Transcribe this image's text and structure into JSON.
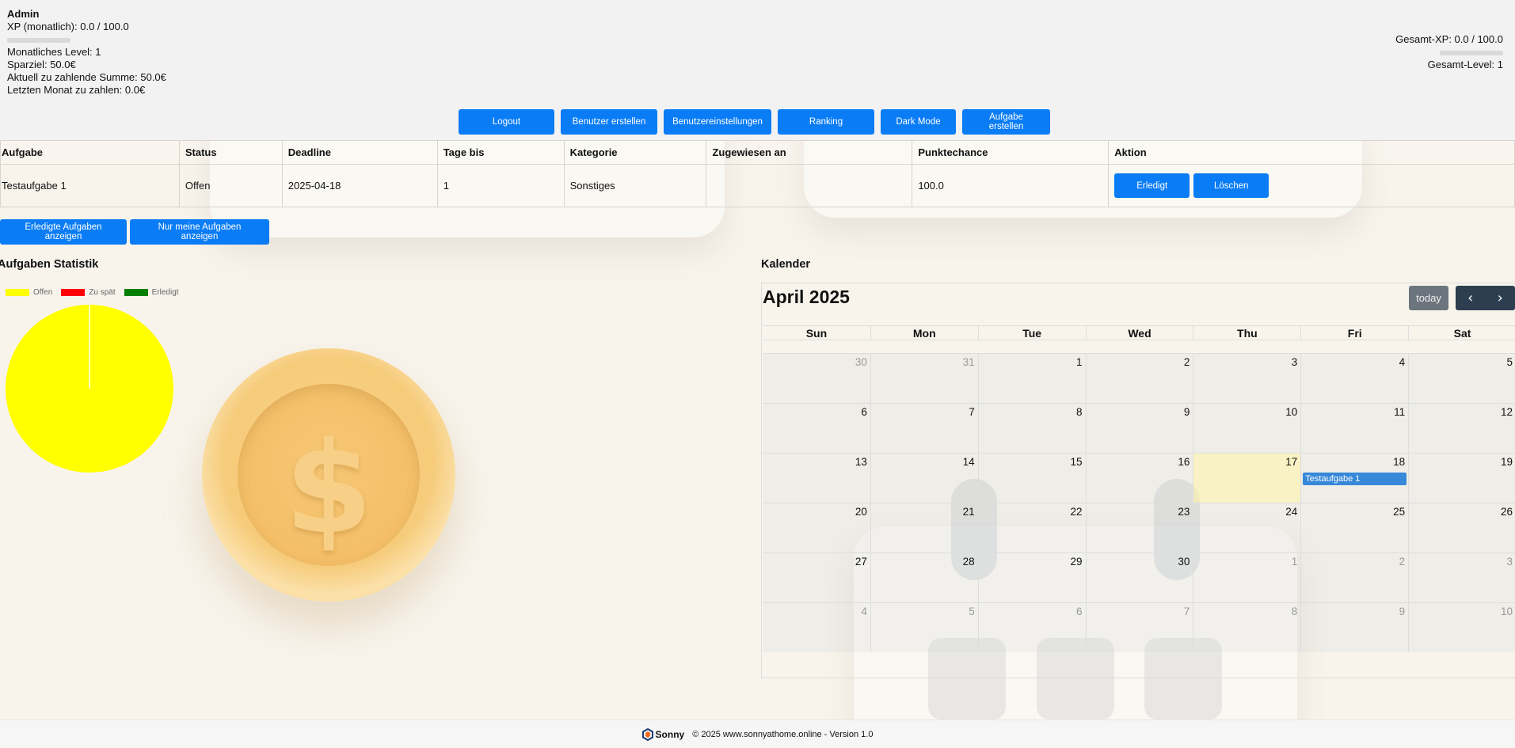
{
  "user": {
    "name": "Admin",
    "xp_monthly": "XP (monatlich): 0.0 / 100.0",
    "xp_monthly_progress": 0,
    "monthly_level": "Monatliches Level: 1",
    "savings_goal": "Sparziel: 50.0€",
    "current_amount": "Aktuell zu zahlende Summe: 50.0€",
    "last_month": "Letzten Monat zu zahlen: 0.0€",
    "total_xp": "Gesamt-XP: 0.0 / 100.0",
    "total_xp_progress": 0,
    "total_level": "Gesamt-Level: 1"
  },
  "nav": {
    "logout": "Logout",
    "create_user": "Benutzer erstellen",
    "user_settings": "Benutzereinstellungen",
    "ranking": "Ranking",
    "dark_mode": "Dark Mode",
    "create_task": "Aufgabe erstellen"
  },
  "table": {
    "headers": [
      "Aufgabe",
      "Status",
      "Deadline",
      "Tage bis",
      "Kategorie",
      "Zugewiesen an",
      "Punktechance",
      "Aktion"
    ],
    "rows": [
      {
        "task": "Testaufgabe 1",
        "status": "Offen",
        "deadline": "2025-04-18",
        "days_until": "1",
        "category": "Sonstiges",
        "assigned": "",
        "points": "100.0",
        "done_label": "Erledigt",
        "delete_label": "Löschen"
      }
    ]
  },
  "filters": {
    "show_done": "Erledigte Aufgaben anzeigen",
    "only_mine": "Nur meine Aufgaben anzeigen"
  },
  "stats": {
    "title": "Aufgaben Statistik",
    "chart_data": {
      "type": "pie",
      "legend": [
        "Offen",
        "Zu spät",
        "Erledigt"
      ],
      "colors": [
        "#ffff00",
        "#ff0000",
        "#008000"
      ],
      "values": [
        1,
        0,
        0
      ]
    }
  },
  "calendar": {
    "section_title": "Kalender",
    "title": "April 2025",
    "today_label": "today",
    "weekdays": [
      "Sun",
      "Mon",
      "Tue",
      "Wed",
      "Thu",
      "Fri",
      "Sat"
    ],
    "weeks": [
      [
        {
          "d": "30",
          "o": true
        },
        {
          "d": "31",
          "o": true
        },
        {
          "d": "1"
        },
        {
          "d": "2"
        },
        {
          "d": "3"
        },
        {
          "d": "4"
        },
        {
          "d": "5"
        }
      ],
      [
        {
          "d": "6"
        },
        {
          "d": "7"
        },
        {
          "d": "8"
        },
        {
          "d": "9"
        },
        {
          "d": "10"
        },
        {
          "d": "11"
        },
        {
          "d": "12"
        }
      ],
      [
        {
          "d": "13"
        },
        {
          "d": "14"
        },
        {
          "d": "15"
        },
        {
          "d": "16"
        },
        {
          "d": "17",
          "today": true
        },
        {
          "d": "18",
          "event": "Testaufgabe 1"
        },
        {
          "d": "19"
        }
      ],
      [
        {
          "d": "20"
        },
        {
          "d": "21"
        },
        {
          "d": "22"
        },
        {
          "d": "23"
        },
        {
          "d": "24"
        },
        {
          "d": "25"
        },
        {
          "d": "26"
        }
      ],
      [
        {
          "d": "27"
        },
        {
          "d": "28"
        },
        {
          "d": "29"
        },
        {
          "d": "30"
        },
        {
          "d": "1",
          "o": true
        },
        {
          "d": "2",
          "o": true
        },
        {
          "d": "3",
          "o": true
        }
      ],
      [
        {
          "d": "4",
          "o": true
        },
        {
          "d": "5",
          "o": true
        },
        {
          "d": "6",
          "o": true
        },
        {
          "d": "7",
          "o": true
        },
        {
          "d": "8",
          "o": true
        },
        {
          "d": "9",
          "o": true
        },
        {
          "d": "10",
          "o": true
        }
      ]
    ]
  },
  "footer": {
    "logo_text": "Sonny",
    "text": "© 2025 www.sonnyathome.online - Version 1.0"
  }
}
